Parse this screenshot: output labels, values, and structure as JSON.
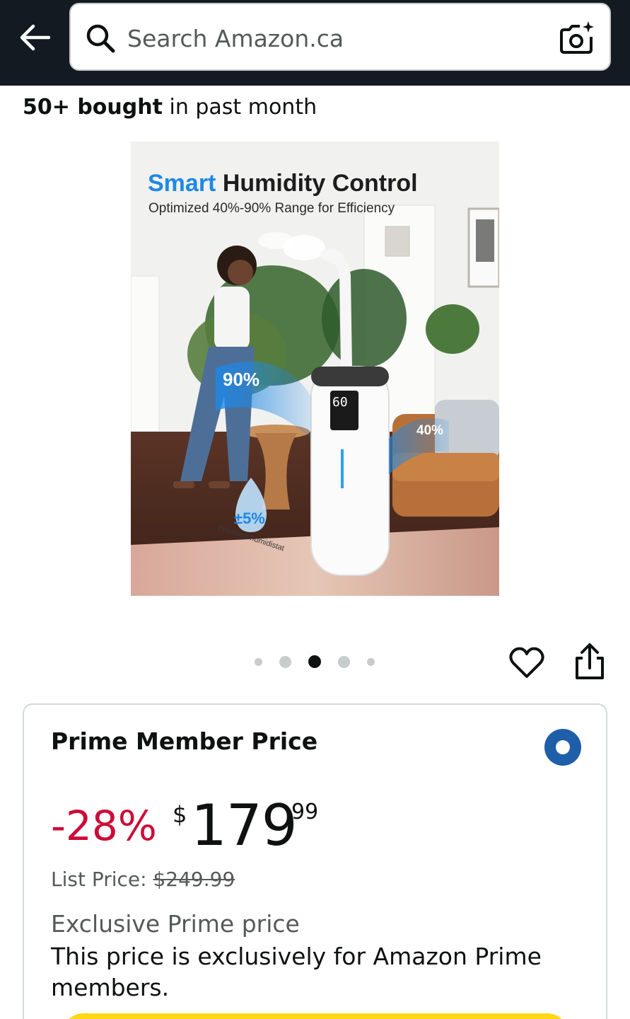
{
  "header": {
    "search_placeholder": "Search Amazon.ca",
    "icons": {
      "back": "arrow-left-icon",
      "search": "search-icon",
      "camera": "camera-search-icon"
    }
  },
  "social_proof": {
    "count": "50+ bought",
    "suffix": " in past month"
  },
  "product_image": {
    "headline_accent": "Smart",
    "headline_rest": " Humidity Control",
    "subhead": "Optimized 40%-90% Range for Efficiency",
    "badge_high": "90%",
    "badge_low": "40%",
    "display_value": "60",
    "precision_value": "±5%",
    "precision_label": "Precision humidistat"
  },
  "carousel": {
    "count": 5,
    "active_index": 2
  },
  "actions": {
    "wishlist_icon": "heart-icon",
    "share_icon": "share-icon"
  },
  "price_card": {
    "title": "Prime Member Price",
    "discount": "-28%",
    "currency": "$",
    "price_whole": "179",
    "price_fraction": "99",
    "list_price_label": "List Price: ",
    "list_price_value": "$249.99",
    "exclusive_title": "Exclusive Prime price",
    "exclusive_desc": "This price is exclusively for Amazon Prime members."
  },
  "colors": {
    "header_bg": "#131a22",
    "discount_red": "#cc0c39",
    "radio_blue": "#1f5ea8",
    "headline_blue": "#1e88e5",
    "buy_yellow": "#ffd814"
  }
}
